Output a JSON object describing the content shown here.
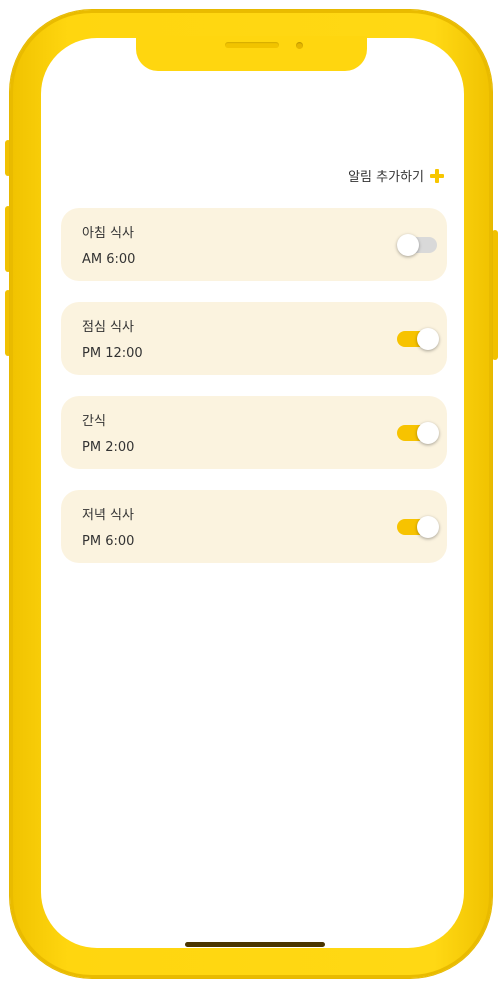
{
  "header": {
    "add_alarm_label": "알림 추가하기"
  },
  "alarms": [
    {
      "name": "아침 식사",
      "time": "AM 6:00",
      "enabled": false
    },
    {
      "name": "점심 식사",
      "time": "PM 12:00",
      "enabled": true
    },
    {
      "name": "간식",
      "time": "PM 2:00",
      "enabled": true
    },
    {
      "name": "저녁 식사",
      "time": "PM 6:00",
      "enabled": true
    }
  ],
  "colors": {
    "accent": "#f7c300",
    "frame": "#ffd60f",
    "card_bg": "#fbf3df",
    "toggle_off": "#d9d9d9",
    "text": "#333333"
  },
  "icons": {
    "add": "plus-icon"
  }
}
